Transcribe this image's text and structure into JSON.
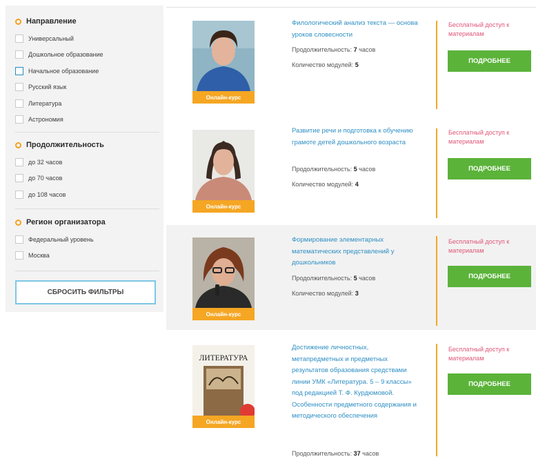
{
  "filters": {
    "direction": {
      "title": "Направление",
      "options": [
        "Универсальный",
        "Дошкольное образование",
        "Начальное образование",
        "Русский язык",
        "Литература",
        "Астрономия"
      ]
    },
    "duration": {
      "title": "Продолжительность",
      "options": [
        "до 32 часов",
        "до 70 часов",
        "до 108 часов"
      ]
    },
    "region": {
      "title": "Регион организатора",
      "options": [
        "Федеральный уровень",
        "Москва"
      ]
    },
    "reset_label": "СБРОСИТЬ ФИЛЬТРЫ"
  },
  "courses": [
    {
      "title": "Филологический анализ текста — основа уроков словесности",
      "duration_label": "Продолжительность:",
      "duration_value": "7",
      "duration_unit": "часов",
      "modules_label": "Количество модулей:",
      "modules_value": "5",
      "badge": "Онлайн-курс",
      "access": "Бесплатный доступ к материалам",
      "button": "ПОДРОБНЕЕ"
    },
    {
      "title": "Развитие речи и подготовка к обучению грамоте детей дошкольного возраста",
      "duration_label": "Продолжительность:",
      "duration_value": "5",
      "duration_unit": "часов",
      "modules_label": "Количество модулей:",
      "modules_value": "4",
      "badge": "Онлайн-курс",
      "access": "Бесплатный доступ к материалам",
      "button": "ПОДРОБНЕЕ"
    },
    {
      "title": "Формирование элементарных математических представлений у дошкольников",
      "duration_label": "Продолжительность:",
      "duration_value": "5",
      "duration_unit": "часов",
      "modules_label": "Количество модулей:",
      "modules_value": "3",
      "badge": "Онлайн-курс",
      "access": "Бесплатный доступ к материалам",
      "button": "ПОДРОБНЕЕ"
    },
    {
      "title": "Достижение личностных, метапредметных и предметных результатов образования средствами линии УМК «Литература. 5 – 9 классы» под редакцией Т. Ф. Курдюмовой. Особенности предметного содержания и методического обеспечения",
      "duration_label": "Продолжительность:",
      "duration_value": "37",
      "duration_unit": "часов",
      "cover_text": "ЛИТЕРАТУРА",
      "badge": "Онлайн-курс",
      "access": "Бесплатный доступ к материалам",
      "button": "ПОДРОБНЕЕ"
    }
  ]
}
